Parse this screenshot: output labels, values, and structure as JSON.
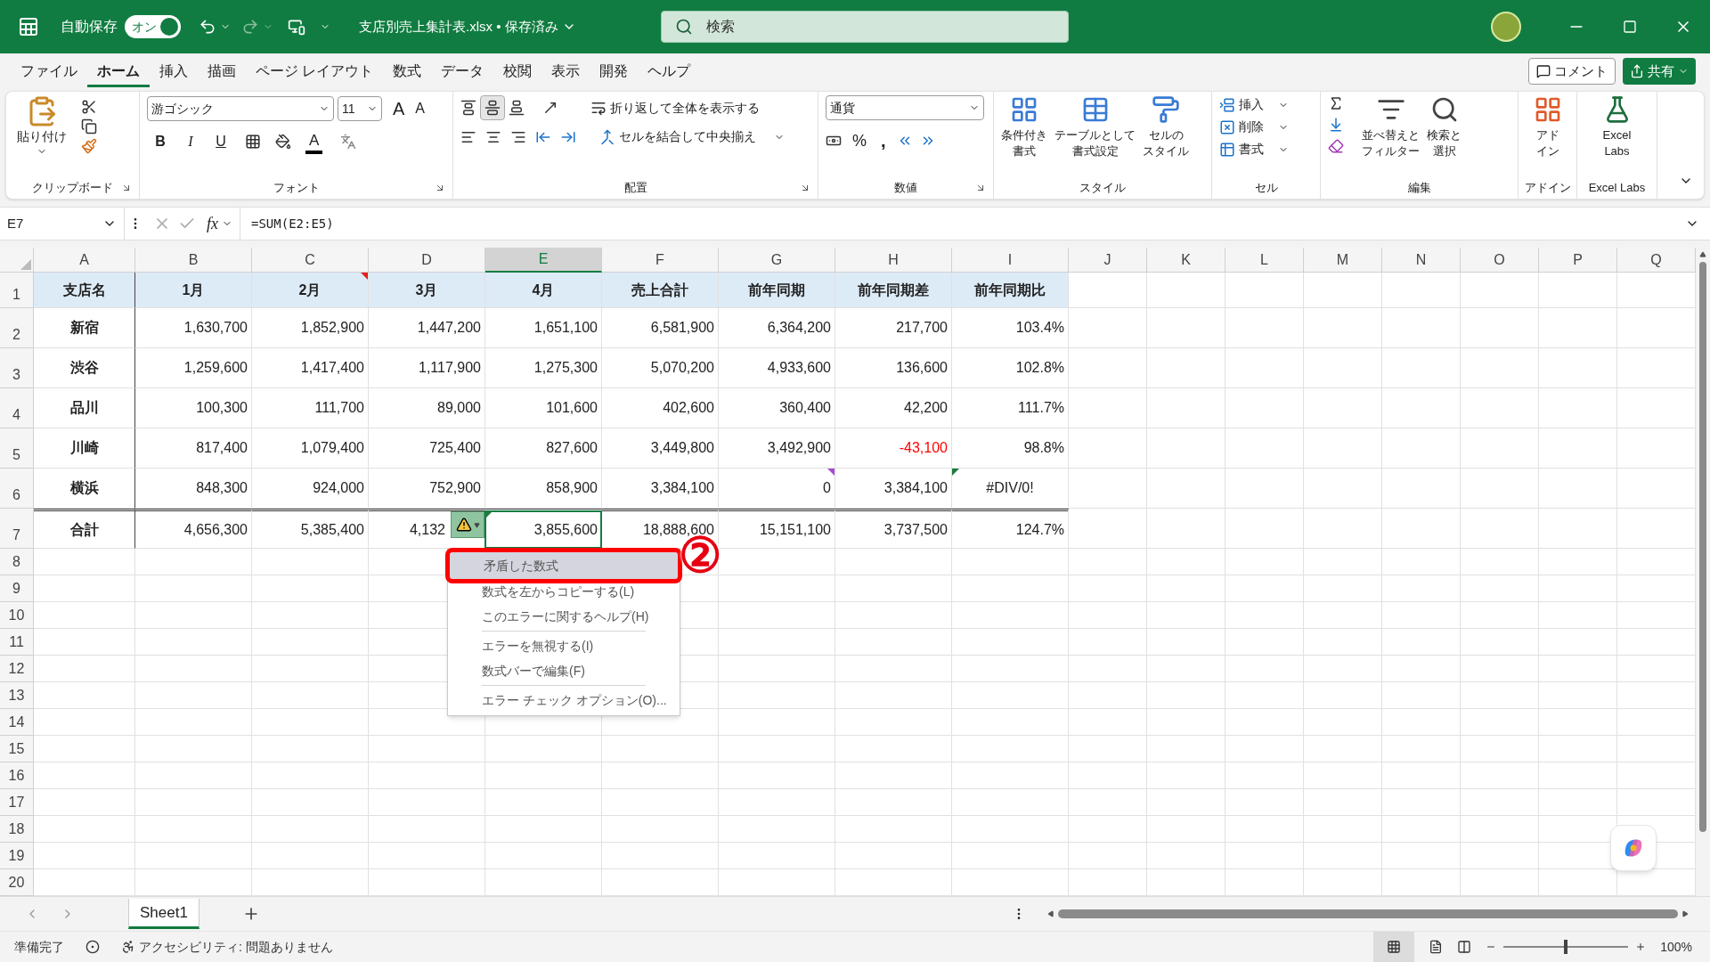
{
  "title_bar": {
    "autosave": {
      "label": "自動保存",
      "toggle_text": "オン",
      "on": true
    },
    "document_title": "支店別売上集計表.xlsx • 保存済み",
    "search": {
      "placeholder": "検索"
    }
  },
  "menu_tabs": [
    {
      "label": "ファイル",
      "selected": false
    },
    {
      "label": "ホーム",
      "selected": true
    },
    {
      "label": "挿入",
      "selected": false
    },
    {
      "label": "描画",
      "selected": false
    },
    {
      "label": "ページ レイアウト",
      "selected": false
    },
    {
      "label": "数式",
      "selected": false
    },
    {
      "label": "データ",
      "selected": false
    },
    {
      "label": "校閲",
      "selected": false
    },
    {
      "label": "表示",
      "selected": false
    },
    {
      "label": "開発",
      "selected": false
    },
    {
      "label": "ヘルプ",
      "selected": false
    }
  ],
  "comment_button": "コメント",
  "share_button": "共有",
  "ribbon": {
    "clipboard": {
      "paste": "貼り付け",
      "title": "クリップボード"
    },
    "font": {
      "font_name": "游ゴシック",
      "font_size": "11",
      "grow": "A",
      "shrink": "A",
      "bold": "B",
      "italic": "I",
      "underline": "U",
      "font_color": "A",
      "title": "フォント"
    },
    "alignment": {
      "wrap": "折り返して全体を表示する",
      "merge": "セルを結合して中央揃え",
      "title": "配置"
    },
    "number": {
      "format": "通貨",
      "percent": "%",
      "comma": ",",
      "title": "数値"
    },
    "styles": {
      "buttons": [
        {
          "lines": [
            "条件付き",
            "書式"
          ]
        },
        {
          "lines": [
            "テーブルとして",
            "書式設定"
          ]
        },
        {
          "lines": [
            "セルの",
            "スタイル"
          ]
        }
      ],
      "title": "スタイル"
    },
    "cells": {
      "buttons": [
        "挿入",
        "削除",
        "書式"
      ],
      "title": "セル"
    },
    "editing": {
      "buttons": [
        {
          "lines": [
            "並べ替えと",
            "フィルター"
          ]
        },
        {
          "lines": [
            "検索と",
            "選択"
          ]
        }
      ],
      "title": "編集"
    },
    "addins": {
      "lines": [
        "アド",
        "イン"
      ],
      "title": "アドイン"
    },
    "labs": {
      "lines": [
        "Excel",
        "Labs"
      ],
      "title": "Excel Labs"
    }
  },
  "formula_bar": {
    "name_box": "E7",
    "fx": "fx",
    "formula": "=SUM(E2:E5)"
  },
  "columns": [
    {
      "label": "A",
      "selected": false
    },
    {
      "label": "B",
      "selected": false
    },
    {
      "label": "C",
      "selected": false
    },
    {
      "label": "D",
      "selected": false
    },
    {
      "label": "E",
      "selected": true
    },
    {
      "label": "F",
      "selected": false
    },
    {
      "label": "G",
      "selected": false
    },
    {
      "label": "H",
      "selected": false
    },
    {
      "label": "I",
      "selected": false
    },
    {
      "label": "J",
      "selected": false
    },
    {
      "label": "K",
      "selected": false
    },
    {
      "label": "L",
      "selected": false
    },
    {
      "label": "M",
      "selected": false
    },
    {
      "label": "N",
      "selected": false
    },
    {
      "label": "O",
      "selected": false
    },
    {
      "label": "P",
      "selected": false
    },
    {
      "label": "Q",
      "selected": false
    }
  ],
  "rows": [
    {
      "number": "1",
      "kind": "header",
      "cells": [
        "支店名",
        "1月",
        {
          "text": "2月",
          "has_comment": true
        },
        "3月",
        "4月",
        "売上合計",
        "前年同期",
        "前年同期差",
        "前年同期比"
      ]
    },
    {
      "number": "2",
      "kind": "data",
      "cells": [
        "新宿",
        "1,630,700",
        "1,852,900",
        "1,447,200",
        "1,651,100",
        "6,581,900",
        "6,364,200",
        "217,700",
        "103.4%"
      ]
    },
    {
      "number": "3",
      "kind": "data",
      "cells": [
        "渋谷",
        "1,259,600",
        "1,417,400",
        "1,117,900",
        "1,275,300",
        "5,070,200",
        "4,933,600",
        "136,600",
        "102.8%"
      ]
    },
    {
      "number": "4",
      "kind": "data",
      "cells": [
        "品川",
        "100,300",
        "111,700",
        "89,000",
        "101,600",
        "402,600",
        "360,400",
        "42,200",
        "111.7%"
      ]
    },
    {
      "number": "5",
      "kind": "data",
      "cells": [
        "川崎",
        "817,400",
        "1,079,400",
        "725,400",
        "827,600",
        "3,449,800",
        "3,492,900",
        {
          "text": "-43,100",
          "color": "#ff0000"
        },
        "98.8%"
      ]
    },
    {
      "number": "6",
      "kind": "data",
      "cells": [
        "横浜",
        "848,300",
        "924,000",
        "752,900",
        "858,900",
        "3,384,100",
        {
          "text": "0",
          "has_note": true
        },
        "3,384,100",
        {
          "text": "#DIV/0!",
          "kind": "error_value",
          "error_indicator": true
        }
      ]
    },
    {
      "number": "7",
      "kind": "total",
      "cells": [
        "合計",
        "4,656,300",
        "5,385,400",
        {
          "text": "4,132",
          "smart_tag": true
        },
        {
          "text": "3,855,600",
          "selected": true,
          "error_indicator": true
        },
        "18,888,600",
        "15,151,100",
        "3,737,500",
        "124.7%"
      ]
    },
    {
      "number": "8",
      "kind": "empty"
    },
    {
      "number": "9",
      "kind": "empty"
    },
    {
      "number": "10",
      "kind": "empty"
    },
    {
      "number": "11",
      "kind": "empty"
    },
    {
      "number": "12",
      "kind": "empty"
    },
    {
      "number": "13",
      "kind": "empty"
    },
    {
      "number": "14",
      "kind": "empty"
    },
    {
      "number": "15",
      "kind": "empty"
    },
    {
      "number": "16",
      "kind": "empty"
    },
    {
      "number": "17",
      "kind": "empty"
    },
    {
      "number": "18",
      "kind": "empty"
    },
    {
      "number": "19",
      "kind": "empty"
    },
    {
      "number": "20",
      "kind": "empty"
    }
  ],
  "error_menu": {
    "items": [
      {
        "label": "矛盾した数式",
        "selected": true,
        "separator_before": false
      },
      {
        "label": "数式を左からコピーする(L)",
        "selected": false,
        "separator_before": false
      },
      {
        "label": "このエラーに関するヘルプ(H)",
        "selected": false,
        "separator_before": false
      },
      {
        "label": "エラーを無視する(I)",
        "selected": false,
        "separator_before": true
      },
      {
        "label": "数式バーで編集(F)",
        "selected": false,
        "separator_before": false
      },
      {
        "label": "エラー チェック オプション(O)...",
        "selected": false,
        "separator_before": true
      }
    ]
  },
  "annotation": {
    "label": "②"
  },
  "sheet_tabs": [
    {
      "label": "Sheet1",
      "selected": true
    }
  ],
  "status_bar": {
    "ready": "準備完了",
    "accessibility": "アクセシビリティ: 問題ありません",
    "zoom": {
      "level": 0.5,
      "reading": "100%"
    }
  }
}
